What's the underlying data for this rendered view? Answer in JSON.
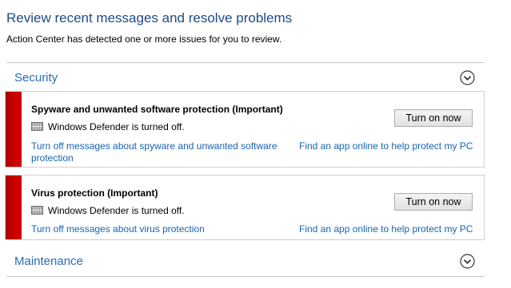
{
  "page": {
    "title": "Review recent messages and resolve problems",
    "subtitle": "Action Center has detected one or more issues for you to review."
  },
  "sections": {
    "security": {
      "title": "Security",
      "toggle_icon": "chevron-down-circle-icon"
    },
    "maintenance": {
      "title": "Maintenance",
      "toggle_icon": "chevron-down-circle-icon"
    }
  },
  "messages": [
    {
      "title": "Spyware and unwanted software protection  (Important)",
      "status": "Windows Defender is turned off.",
      "status_icon": "windows-defender-icon",
      "severity_color": "#c40000",
      "button_label": "Turn on now",
      "turn_off_link": "Turn off messages about spyware and unwanted software protection",
      "find_app_link": "Find an app online to help protect my PC"
    },
    {
      "title": "Virus protection  (Important)",
      "status": "Windows Defender is turned off.",
      "status_icon": "windows-defender-icon",
      "severity_color": "#c40000",
      "button_label": "Turn on now",
      "turn_off_link": "Turn off messages about virus protection",
      "find_app_link": "Find an app online to help protect my PC"
    }
  ],
  "colors": {
    "title_blue": "#1e4a88",
    "section_blue": "#2a6cb3",
    "link_blue": "#1763b3",
    "critical_red": "#c40000"
  }
}
